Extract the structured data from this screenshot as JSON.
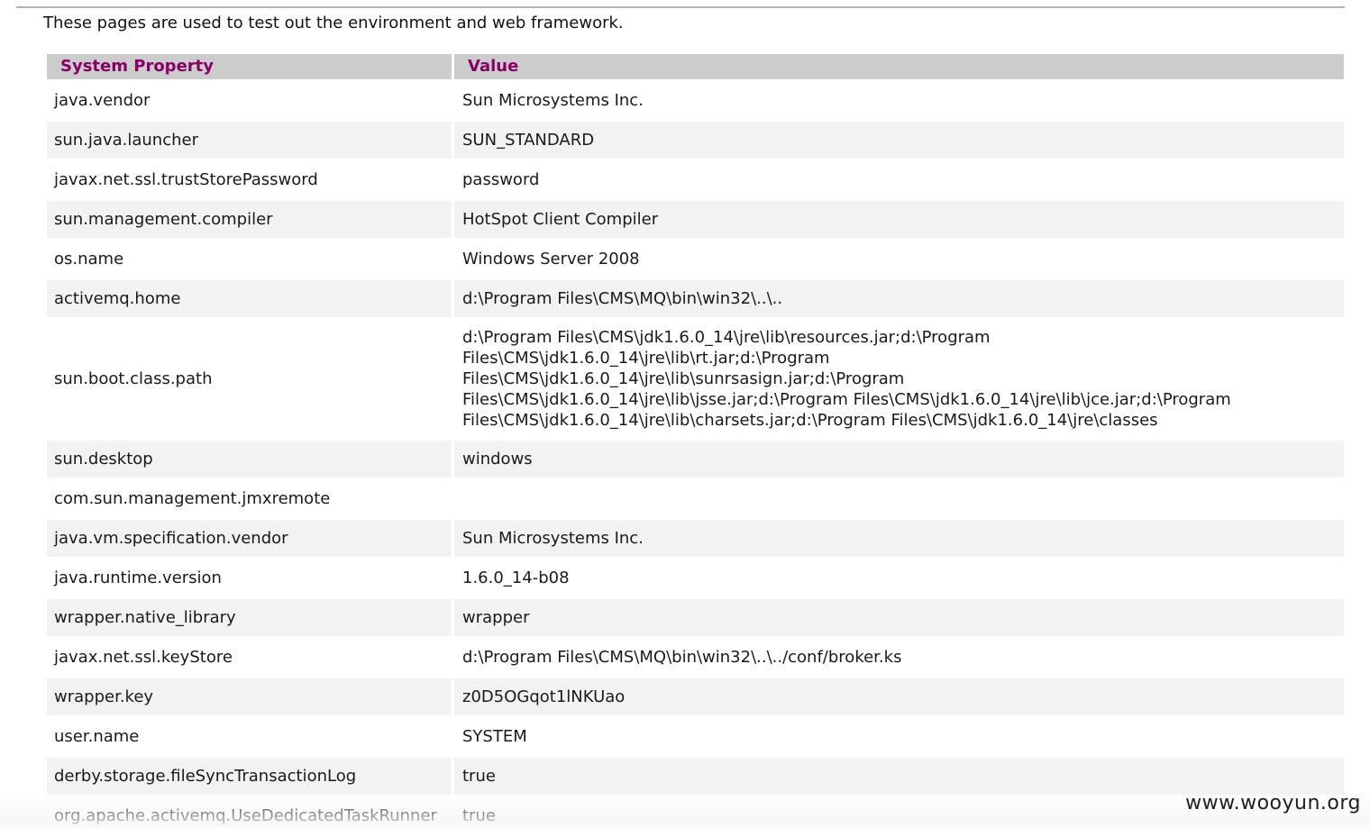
{
  "intro_text": "These pages are used to test out the environment and web framework.",
  "table": {
    "headers": [
      "System Property",
      "Value"
    ],
    "rows": [
      {
        "property": "java.vendor",
        "value": "Sun Microsystems Inc."
      },
      {
        "property": "sun.java.launcher",
        "value": "SUN_STANDARD"
      },
      {
        "property": "javax.net.ssl.trustStorePassword",
        "value": "password"
      },
      {
        "property": "sun.management.compiler",
        "value": "HotSpot Client Compiler"
      },
      {
        "property": "os.name",
        "value": "Windows Server 2008"
      },
      {
        "property": "activemq.home",
        "value": "d:\\Program Files\\CMS\\MQ\\bin\\win32\\..\\.."
      },
      {
        "property": "sun.boot.class.path",
        "value": "d:\\Program Files\\CMS\\jdk1.6.0_14\\jre\\lib\\resources.jar;d:\\Program\nFiles\\CMS\\jdk1.6.0_14\\jre\\lib\\rt.jar;d:\\Program\nFiles\\CMS\\jdk1.6.0_14\\jre\\lib\\sunrsasign.jar;d:\\Program\nFiles\\CMS\\jdk1.6.0_14\\jre\\lib\\jsse.jar;d:\\Program Files\\CMS\\jdk1.6.0_14\\jre\\lib\\jce.jar;d:\\Program\nFiles\\CMS\\jdk1.6.0_14\\jre\\lib\\charsets.jar;d:\\Program Files\\CMS\\jdk1.6.0_14\\jre\\classes"
      },
      {
        "property": "sun.desktop",
        "value": "windows"
      },
      {
        "property": "com.sun.management.jmxremote",
        "value": ""
      },
      {
        "property": "java.vm.specification.vendor",
        "value": "Sun Microsystems Inc."
      },
      {
        "property": "java.runtime.version",
        "value": "1.6.0_14-b08"
      },
      {
        "property": "wrapper.native_library",
        "value": "wrapper"
      },
      {
        "property": "javax.net.ssl.keyStore",
        "value": "d:\\Program Files\\CMS\\MQ\\bin\\win32\\..\\../conf/broker.ks"
      },
      {
        "property": "wrapper.key",
        "value": "z0D5OGqot1lNKUao"
      },
      {
        "property": "user.name",
        "value": "SYSTEM"
      },
      {
        "property": "derby.storage.fileSyncTransactionLog",
        "value": "true"
      },
      {
        "property": "org.apache.activemq.UseDedicatedTaskRunner",
        "value": "true"
      }
    ]
  },
  "watermark": "www.wooyun.org",
  "colors": {
    "header_bg": "#cccccc",
    "header_text": "#880066",
    "row_alt_bg": "#f2f2f2",
    "row_bg": "#ffffff"
  }
}
